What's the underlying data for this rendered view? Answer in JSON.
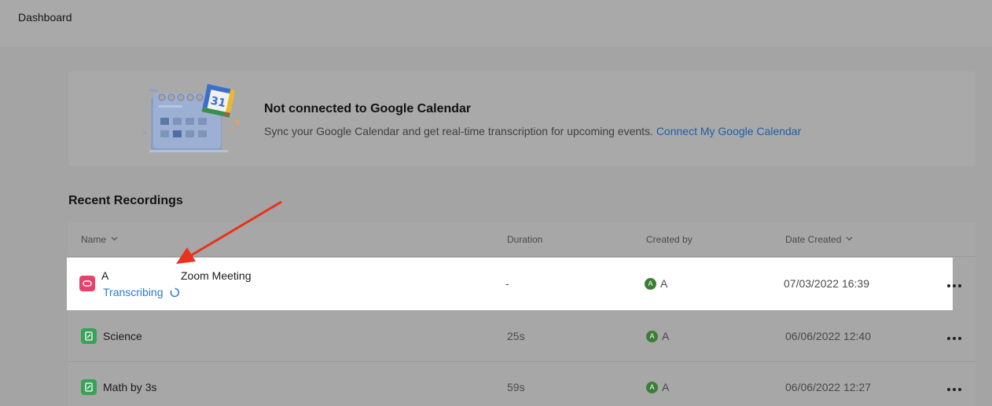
{
  "header": {
    "title": "Dashboard"
  },
  "banner": {
    "heading": "Not connected to Google Calendar",
    "description": "Sync your Google Calendar and get real-time transcription for upcoming events.",
    "link": "Connect My Google Calendar",
    "calendar_day": "31"
  },
  "recordings": {
    "title": "Recent Recordings",
    "columns": {
      "name": "Name",
      "duration": "Duration",
      "created_by": "Created by",
      "date_created": "Date Created"
    },
    "rows": [
      {
        "name": "A",
        "name_suffix": "Zoom Meeting",
        "status": "Transcribing",
        "duration": "-",
        "creator_initial": "A",
        "creator": "A",
        "date": "07/03/2022 16:39",
        "icon": "zoom-icon"
      },
      {
        "name": "Science",
        "duration": "25s",
        "creator_initial": "A",
        "creator": "A",
        "date": "06/06/2022 12:40",
        "icon": "document-icon"
      },
      {
        "name": "Math by 3s",
        "duration": "59s",
        "creator_initial": "A",
        "creator": "A",
        "date": "06/06/2022 12:27",
        "icon": "document-icon"
      }
    ]
  },
  "colors": {
    "link": "#1d5fa8",
    "status": "#2b78d4",
    "zoom_icon": "#e8416b",
    "doc_icon": "#3aa15a",
    "avatar": "#3c7d35",
    "annotation_arrow": "#e8321e"
  }
}
